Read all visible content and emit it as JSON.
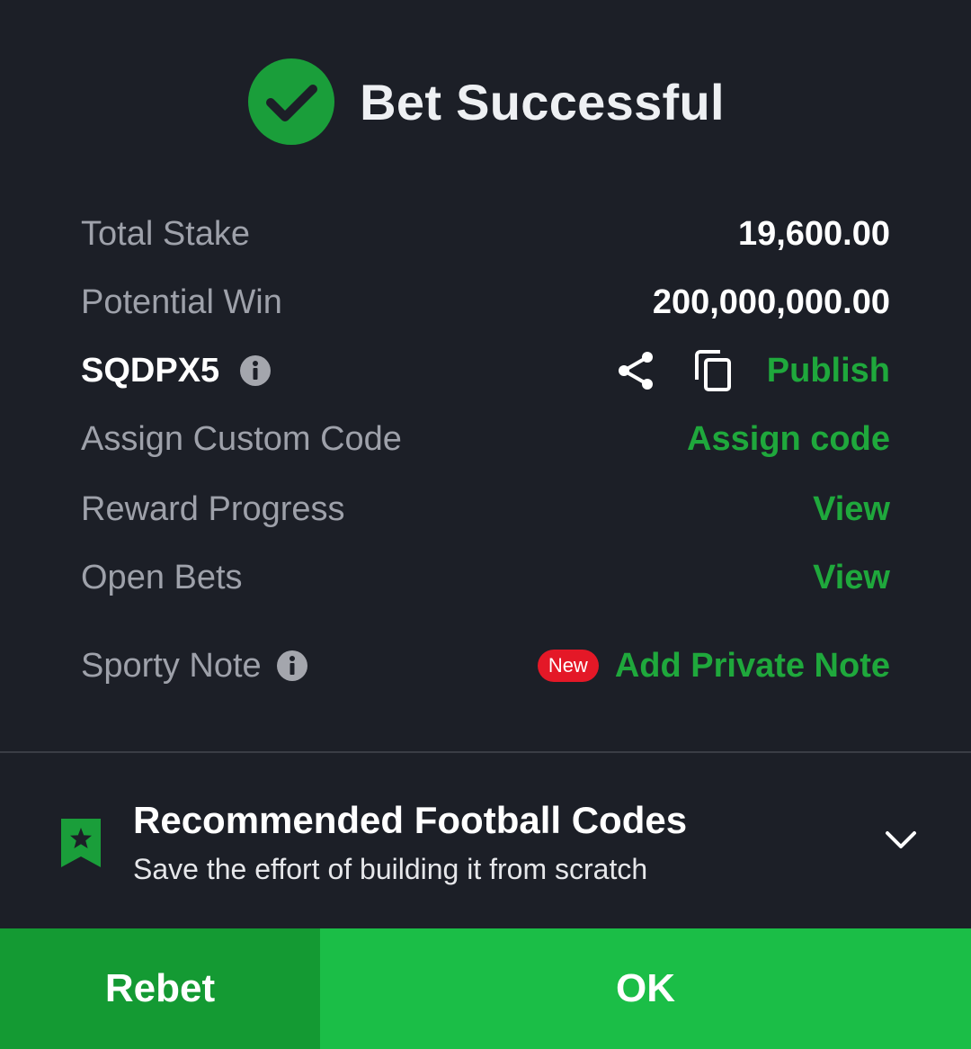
{
  "header": {
    "title": "Bet Successful"
  },
  "summary": {
    "total_stake_label": "Total Stake",
    "total_stake_value": "19,600.00",
    "potential_win_label": "Potential Win",
    "potential_win_value": "200,000,000.00",
    "booking_code": "SQDPX5",
    "publish_label": "Publish",
    "assign_custom_code_label": "Assign Custom Code",
    "assign_code_link": "Assign code",
    "reward_progress_label": "Reward Progress",
    "reward_progress_link": "View",
    "open_bets_label": "Open Bets",
    "open_bets_link": "View",
    "sporty_note_label": "Sporty Note",
    "new_badge": "New",
    "add_private_note_link": "Add Private Note"
  },
  "recommended": {
    "title": "Recommended Football Codes",
    "subtitle": "Save the effort of building it from scratch"
  },
  "buttons": {
    "rebet": "Rebet",
    "ok": "OK"
  },
  "colors": {
    "background": "#1c1f27",
    "accent_green": "#1fa83c",
    "rebet_green": "#149a33",
    "ok_green": "#1bbe47",
    "badge_red": "#e41827"
  },
  "icons": {
    "success": "check-circle-icon",
    "info": "info-icon",
    "share": "share-icon",
    "copy": "copy-icon",
    "bookmark": "bookmark-star-icon",
    "chevron": "chevron-down-icon"
  }
}
